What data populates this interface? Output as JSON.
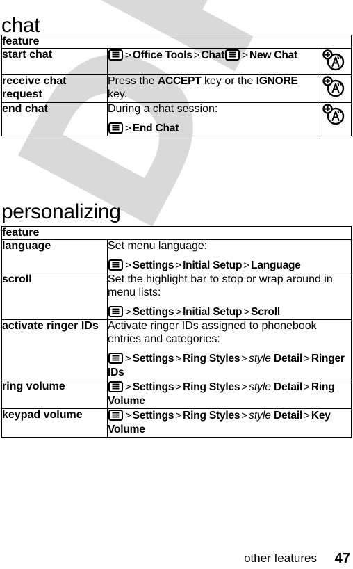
{
  "watermark": {
    "text": "DRAFT"
  },
  "sections": [
    {
      "id": "chat",
      "title": "chat",
      "table": {
        "header": "feature",
        "rows": [
          {
            "feature": "start chat",
            "lines": [
              {
                "type": "path",
                "parts": [
                  {
                    "kind": "menu-icon",
                    "name": "menu-key-icon"
                  },
                  {
                    "kind": "gt",
                    "text": ">"
                  },
                  {
                    "kind": "bold",
                    "text": "Office Tools"
                  },
                  {
                    "kind": "gt",
                    "text": ">"
                  },
                  {
                    "kind": "bold",
                    "text": "Chat"
                  },
                  {
                    "kind": "menu-icon",
                    "name": "menu-key-icon"
                  },
                  {
                    "kind": "gt",
                    "text": ">"
                  },
                  {
                    "kind": "bold",
                    "text": "New Chat"
                  }
                ]
              }
            ],
            "icon": "network-feature-icon"
          },
          {
            "feature": "receive chat request",
            "lines": [
              {
                "type": "text",
                "parts": [
                  {
                    "kind": "plain",
                    "text": "Press the "
                  },
                  {
                    "kind": "bold",
                    "text": "ACCEPT"
                  },
                  {
                    "kind": "plain",
                    "text": " key or the "
                  },
                  {
                    "kind": "bold",
                    "text": "IGNORE"
                  },
                  {
                    "kind": "plain",
                    "text": " key."
                  }
                ]
              }
            ],
            "icon": "network-feature-icon"
          },
          {
            "feature": "end chat",
            "lines": [
              {
                "type": "text",
                "parts": [
                  {
                    "kind": "plain",
                    "text": "During a chat session:"
                  }
                ]
              },
              {
                "type": "path",
                "parts": [
                  {
                    "kind": "menu-icon",
                    "name": "menu-key-icon"
                  },
                  {
                    "kind": "gt",
                    "text": ">"
                  },
                  {
                    "kind": "bold",
                    "text": "End Chat"
                  }
                ]
              }
            ],
            "icon": "network-feature-icon"
          }
        ]
      }
    },
    {
      "id": "personalizing",
      "title": "personalizing",
      "table": {
        "header": "feature",
        "rows": [
          {
            "feature": "language",
            "lines": [
              {
                "type": "text",
                "parts": [
                  {
                    "kind": "plain",
                    "text": "Set menu language:"
                  }
                ]
              },
              {
                "type": "path",
                "parts": [
                  {
                    "kind": "menu-icon",
                    "name": "menu-key-icon"
                  },
                  {
                    "kind": "gt",
                    "text": ">"
                  },
                  {
                    "kind": "bold",
                    "text": "Settings"
                  },
                  {
                    "kind": "gt",
                    "text": ">"
                  },
                  {
                    "kind": "bold",
                    "text": "Initial Setup"
                  },
                  {
                    "kind": "gt",
                    "text": ">"
                  },
                  {
                    "kind": "bold",
                    "text": "Language"
                  }
                ]
              }
            ],
            "icon": null
          },
          {
            "feature": "scroll",
            "lines": [
              {
                "type": "text",
                "parts": [
                  {
                    "kind": "plain",
                    "text": "Set the highlight bar to stop or wrap around in menu lists:"
                  }
                ]
              },
              {
                "type": "path",
                "parts": [
                  {
                    "kind": "menu-icon",
                    "name": "menu-key-icon"
                  },
                  {
                    "kind": "gt",
                    "text": ">"
                  },
                  {
                    "kind": "bold",
                    "text": "Settings"
                  },
                  {
                    "kind": "gt",
                    "text": ">"
                  },
                  {
                    "kind": "bold",
                    "text": "Initial Setup"
                  },
                  {
                    "kind": "gt",
                    "text": ">"
                  },
                  {
                    "kind": "bold",
                    "text": "Scroll"
                  }
                ]
              }
            ],
            "icon": null
          },
          {
            "feature": "activate ringer IDs",
            "lines": [
              {
                "type": "text",
                "parts": [
                  {
                    "kind": "plain",
                    "text": "Activate ringer IDs assigned to phonebook entries and categories:"
                  }
                ]
              },
              {
                "type": "path",
                "parts": [
                  {
                    "kind": "menu-icon",
                    "name": "menu-key-icon"
                  },
                  {
                    "kind": "gt",
                    "text": ">"
                  },
                  {
                    "kind": "bold",
                    "text": "Settings"
                  },
                  {
                    "kind": "gt",
                    "text": ">"
                  },
                  {
                    "kind": "bold",
                    "text": "Ring Styles"
                  },
                  {
                    "kind": "gt",
                    "text": ">"
                  },
                  {
                    "kind": "italic",
                    "text": "style"
                  },
                  {
                    "kind": "bold",
                    "text": " Detail"
                  },
                  {
                    "kind": "gt",
                    "text": ">"
                  },
                  {
                    "kind": "bold",
                    "text": "Ringer IDs"
                  }
                ]
              }
            ],
            "icon": null
          },
          {
            "feature": "ring volume",
            "lines": [
              {
                "type": "path",
                "parts": [
                  {
                    "kind": "menu-icon",
                    "name": "menu-key-icon"
                  },
                  {
                    "kind": "gt",
                    "text": ">"
                  },
                  {
                    "kind": "bold",
                    "text": "Settings"
                  },
                  {
                    "kind": "gt",
                    "text": ">"
                  },
                  {
                    "kind": "bold",
                    "text": "Ring Styles"
                  },
                  {
                    "kind": "gt",
                    "text": ">"
                  },
                  {
                    "kind": "italic",
                    "text": "style"
                  },
                  {
                    "kind": "bold",
                    "text": " Detail"
                  },
                  {
                    "kind": "gt",
                    "text": ">"
                  },
                  {
                    "kind": "bold",
                    "text": "Ring Volume"
                  }
                ]
              }
            ],
            "icon": null
          },
          {
            "feature": "keypad volume",
            "lines": [
              {
                "type": "path",
                "parts": [
                  {
                    "kind": "menu-icon",
                    "name": "menu-key-icon"
                  },
                  {
                    "kind": "gt",
                    "text": ">"
                  },
                  {
                    "kind": "bold",
                    "text": "Settings"
                  },
                  {
                    "kind": "gt",
                    "text": ">"
                  },
                  {
                    "kind": "bold",
                    "text": "Ring Styles"
                  },
                  {
                    "kind": "gt",
                    "text": ">"
                  },
                  {
                    "kind": "italic",
                    "text": "style"
                  },
                  {
                    "kind": "bold",
                    "text": " Detail"
                  },
                  {
                    "kind": "gt",
                    "text": ">"
                  },
                  {
                    "kind": "bold",
                    "text": "Key Volume"
                  }
                ]
              }
            ],
            "icon": null
          }
        ]
      }
    }
  ],
  "footer": {
    "label": "other features",
    "page_number": "47"
  },
  "colors": {
    "ink": "#000000",
    "paper": "#ffffff",
    "watermark": "#d9d9d9"
  }
}
